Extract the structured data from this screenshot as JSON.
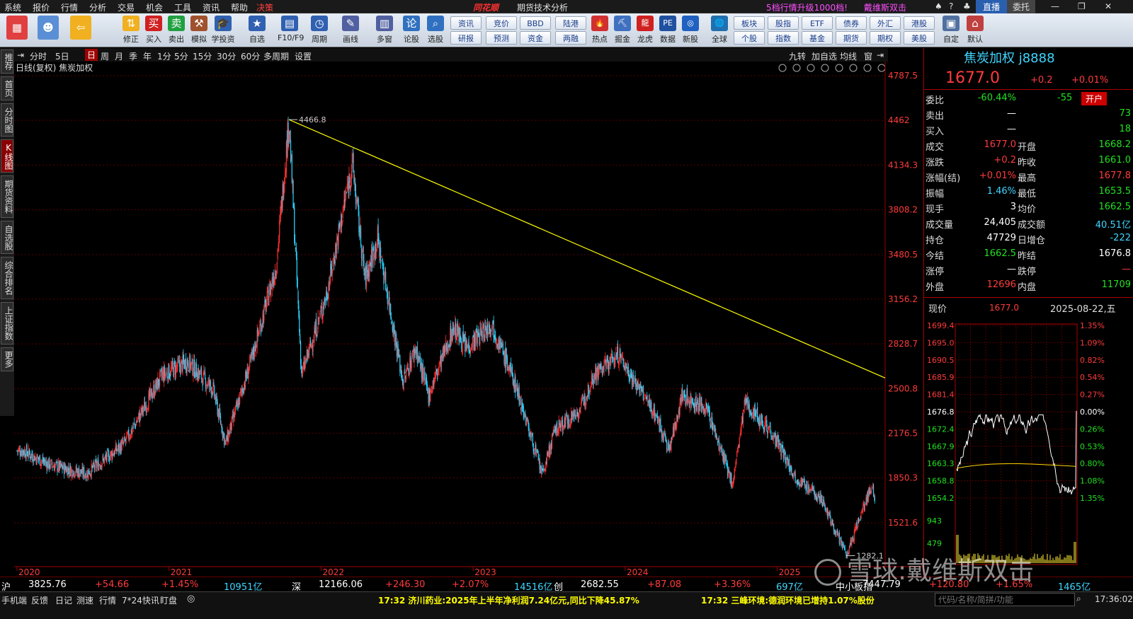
{
  "menu": [
    "系统",
    "报价",
    "行情",
    "分析",
    "交易",
    "机会",
    "工具",
    "资讯",
    "帮助",
    "决策"
  ],
  "app_logo": "同花顺",
  "window_title": "期货技术分析",
  "upgrade_notice": "5档行情升级1000档!",
  "user": "戴维斯双击",
  "live_btn": "直播",
  "trust_btn": "委托",
  "toolbar": {
    "left": [
      {
        "icon": "windows-icon",
        "label": ""
      },
      {
        "icon": "robot-icon",
        "label": ""
      },
      {
        "icon": "back-arrow-icon",
        "label": ""
      },
      {
        "icon": "up-down-icon",
        "label": "修正"
      },
      {
        "icon": "buy-icon",
        "label": "买入"
      },
      {
        "icon": "sell-icon",
        "label": "卖出"
      },
      {
        "icon": "hammer-icon",
        "label": "模拟"
      },
      {
        "icon": "graduation-icon",
        "label": "学投资"
      },
      {
        "icon": "star-icon",
        "label": "自选"
      },
      {
        "icon": "grid-icon",
        "label": "F10/F9"
      },
      {
        "icon": "clock-icon",
        "label": "周期"
      },
      {
        "icon": "pen-icon",
        "label": "画线"
      },
      {
        "icon": "multi-window-icon",
        "label": "多窗"
      },
      {
        "icon": "lun-icon",
        "label": "论股"
      },
      {
        "icon": "search-stock-icon",
        "label": "选股"
      }
    ],
    "mid_buttons": [
      [
        "资讯",
        "研报"
      ],
      [
        "竞价",
        "预测"
      ],
      [
        "BBD",
        "资金"
      ],
      [
        "陆港",
        "两融"
      ]
    ],
    "right": [
      {
        "icon": "hot-icon",
        "label": "热点"
      },
      {
        "icon": "gold-icon",
        "label": "掘金"
      },
      {
        "icon": "dragon-icon",
        "label": "龙虎"
      },
      {
        "icon": "pe-icon",
        "label": "数据"
      },
      {
        "icon": "ipo-icon",
        "label": "新股"
      },
      {
        "icon": "globe-icon",
        "label": "全球"
      }
    ],
    "market_buttons": [
      [
        "板块",
        "个股"
      ],
      [
        "股指",
        "指数"
      ],
      [
        "ETF",
        "基金"
      ],
      [
        "债券",
        "期货"
      ],
      [
        "外汇",
        "期权"
      ],
      [
        "港股",
        "美股"
      ]
    ],
    "end": [
      {
        "icon": "custom-icon",
        "label": "自定"
      },
      {
        "icon": "home-icon",
        "label": "默认"
      }
    ]
  },
  "periods": [
    "分时",
    "5日",
    "日",
    "周",
    "月",
    "季",
    "年",
    "1分",
    "5分",
    "15分",
    "30分",
    "60分",
    "多周期",
    "设置"
  ],
  "period_right": [
    "九转",
    "加自选",
    "均线",
    "窗"
  ],
  "side_tabs": [
    "推荐",
    "首页",
    "分时图",
    "K线图",
    "期货资料",
    "自选股",
    "综合排名",
    "上证指数",
    "更多"
  ],
  "chart_header": "日线(复权)  焦炭加权",
  "chart_data": {
    "type": "candlestick",
    "x_labels": [
      "2020",
      "2021",
      "2022",
      "2023",
      "2024",
      "2025"
    ],
    "y_ticks": [
      4787.5,
      4462.0,
      4134.3,
      3808.2,
      3480.5,
      3156.2,
      2828.7,
      2500.8,
      2176.5,
      1850.3,
      1521.6
    ],
    "annotations": [
      "4466.8",
      "1282.1"
    ],
    "trend_points": [
      [
        "2020-01",
        2050
      ],
      [
        "2020-03",
        1950
      ],
      [
        "2020-06",
        1880
      ],
      [
        "2020-09",
        2100
      ],
      [
        "2020-12",
        2600
      ],
      [
        "2021-02",
        2700
      ],
      [
        "2021-04",
        2500
      ],
      [
        "2021-05",
        2100
      ],
      [
        "2021-07",
        2700
      ],
      [
        "2021-09",
        3400
      ],
      [
        "2021-10",
        4466.8
      ],
      [
        "2021-11",
        2600
      ],
      [
        "2022-01",
        3200
      ],
      [
        "2022-03",
        4150
      ],
      [
        "2022-04",
        3300
      ],
      [
        "2022-05",
        3600
      ],
      [
        "2022-07",
        2550
      ],
      [
        "2022-08",
        2800
      ],
      [
        "2022-09",
        2450
      ],
      [
        "2022-11",
        2950
      ],
      [
        "2022-12",
        2800
      ],
      [
        "2023-02",
        2980
      ],
      [
        "2023-04",
        2500
      ],
      [
        "2023-06",
        1870
      ],
      [
        "2023-07",
        2200
      ],
      [
        "2023-09",
        2350
      ],
      [
        "2023-10",
        2600
      ],
      [
        "2023-12",
        2750
      ],
      [
        "2024-01",
        2600
      ],
      [
        "2024-03",
        2300
      ],
      [
        "2024-04",
        2050
      ],
      [
        "2024-05",
        2450
      ],
      [
        "2024-07",
        2350
      ],
      [
        "2024-09",
        1800
      ],
      [
        "2024-10",
        2400
      ],
      [
        "2024-12",
        2200
      ],
      [
        "2025-02",
        1850
      ],
      [
        "2025-04",
        1700
      ],
      [
        "2025-06",
        1282.1
      ],
      [
        "2025-07",
        1550
      ],
      [
        "2025-08",
        1800
      ],
      [
        "2025-08-22",
        1677.0
      ]
    ],
    "trendline": [
      [
        "2021-10",
        4466.8
      ],
      [
        "2025-08-22",
        2580
      ]
    ]
  },
  "quote": {
    "name": "焦炭加权 j8888",
    "price": "1677.0",
    "change": "+0.2",
    "pct": "+0.01%",
    "open_btn": "开户",
    "rows": [
      [
        "委比",
        "-60.44%",
        "-55",
        ""
      ],
      [
        "卖出",
        "—",
        "",
        "73"
      ],
      [
        "买入",
        "—",
        "",
        "18"
      ],
      [
        "成交",
        "1677.0",
        "开盘",
        "1668.2"
      ],
      [
        "涨跌",
        "+0.2",
        "昨收",
        "1661.0"
      ],
      [
        "涨幅(结)",
        "+0.01%",
        "最高",
        "1677.8"
      ],
      [
        "振幅",
        "1.46%",
        "最低",
        "1653.5"
      ],
      [
        "现手",
        "3",
        "均价",
        "1662.5"
      ],
      [
        "成交量",
        "24,405",
        "成交额",
        "40.51亿"
      ],
      [
        "持仓",
        "47729",
        "日增仓",
        "-222"
      ],
      [
        "今结",
        "1662.5",
        "昨结",
        "1676.8"
      ],
      [
        "涨停",
        "—",
        "跌停",
        "—"
      ],
      [
        "外盘",
        "12696",
        "内盘",
        "11709"
      ]
    ],
    "intraday_label": "现价",
    "intraday_price": "1677.0",
    "date": "2025-08-22,五",
    "mini_left": [
      "1699.4",
      "1695.0",
      "1690.5",
      "1685.9",
      "1681.4",
      "1676.8",
      "1672.4",
      "1667.9",
      "1663.3",
      "1658.8",
      "1654.2",
      "943",
      "479"
    ],
    "mini_right": [
      "1.35%",
      "1.09%",
      "0.82%",
      "0.54%",
      "0.27%",
      "0.00%",
      "0.26%",
      "0.53%",
      "0.80%",
      "1.08%",
      "1.35%"
    ]
  },
  "status": [
    [
      "沪",
      "3825.76",
      "+54.66",
      "+1.45%",
      "10951亿"
    ],
    [
      "深",
      "12166.06",
      "+246.30",
      "+2.07%",
      "14516亿"
    ],
    [
      "创",
      "2682.55",
      "+87.08",
      "+3.36%",
      "697亿"
    ],
    [
      "中小板指",
      "7447.79",
      "+120.80",
      "+1.65%",
      "1465亿"
    ]
  ],
  "bottom_tabs": [
    "手机端",
    "反馈",
    "日记",
    "测速",
    "行情",
    "7*24快讯",
    "盯盘"
  ],
  "news": [
    "17:32 济川药业:2025年上半年净利润7.24亿元,同比下降45.87%",
    "17:32 三峰环境:德润环境已增持1.07%股份"
  ],
  "search_placeholder": "代码/名称/简拼/功能",
  "clock": "17:36:02",
  "watermark": "雪球:戴维斯双击"
}
